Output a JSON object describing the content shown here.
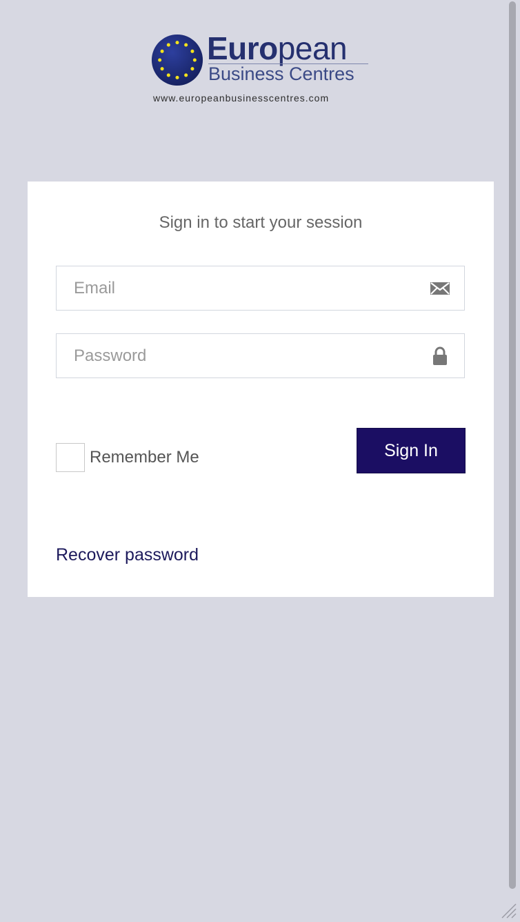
{
  "logo": {
    "title_bold": "Euro",
    "title_rest": "pean",
    "subtitle": "Business Centres",
    "url": "www.europeanbusinesscentres.com",
    "icon": "eu-flag-globe-icon"
  },
  "login": {
    "message": "Sign in to start your session",
    "email": {
      "placeholder": "Email",
      "value": "",
      "icon": "envelope-icon"
    },
    "password": {
      "placeholder": "Password",
      "value": "",
      "icon": "lock-icon"
    },
    "remember_label": "Remember Me",
    "remember_checked": false,
    "signin_label": "Sign In",
    "recover_label": "Recover password"
  },
  "colors": {
    "page_background": "#d7d8e2",
    "card_background": "#ffffff",
    "primary_button": "#1b0e63",
    "link": "#1d1a5c",
    "brand": "#25306f",
    "eu_stars": "#f3e21c"
  }
}
